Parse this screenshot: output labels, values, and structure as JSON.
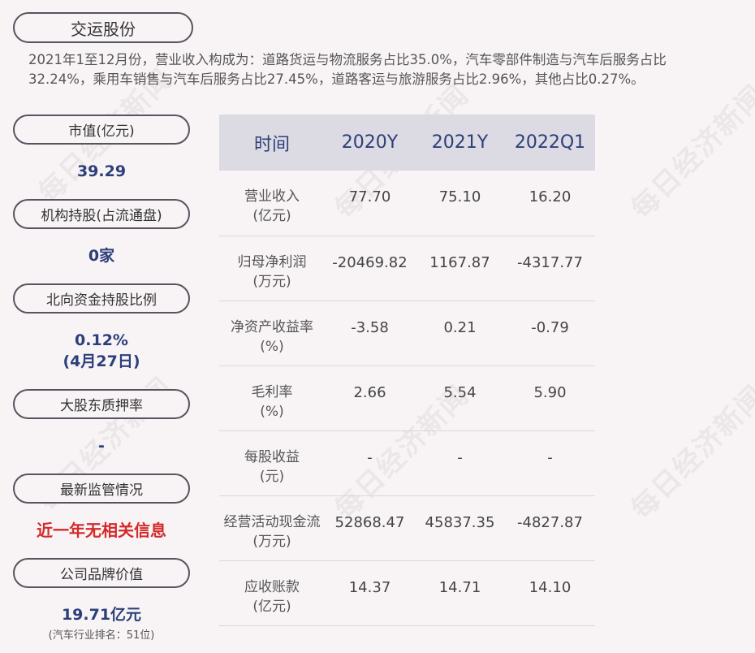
{
  "title": "交运股份",
  "summary": "2021年1至12月份，营业收入构成为：道路货运与物流服务占比35.0%，汽车零部件制造与汽车后服务占比32.24%，乘用车销售与汽车后服务占比27.45%，道路客运与旅游服务占比2.96%，其他占比0.27%。",
  "side": {
    "market_cap_label": "市值(亿元)",
    "market_cap_value": "39.29",
    "inst_label": "机构持股(占流通盘)",
    "inst_value": "0家",
    "north_label": "北向资金持股比例",
    "north_value": "0.12%",
    "north_date": "(4月27日)",
    "pledge_label": "大股东质押率",
    "pledge_value": "-",
    "reg_label": "最新监管情况",
    "reg_value": "近一年无相关信息",
    "brand_label": "公司品牌价值",
    "brand_value": "19.71亿元",
    "brand_note": "(汽车行业排名：51位)"
  },
  "table": {
    "headers": [
      "时间",
      "2020Y",
      "2021Y",
      "2022Q1"
    ],
    "rows": [
      {
        "label1": "营业收入",
        "label2": "(亿元)",
        "v": [
          "77.70",
          "75.10",
          "16.20"
        ]
      },
      {
        "label1": "归母净利润",
        "label2": "(万元)",
        "v": [
          "-20469.82",
          "1167.87",
          "-4317.77"
        ]
      },
      {
        "label1": "净资产收益率",
        "label2": "(%)",
        "v": [
          "-3.58",
          "0.21",
          "-0.79"
        ]
      },
      {
        "label1": "毛利率",
        "label2": "(%)",
        "v": [
          "2.66",
          "5.54",
          "5.90"
        ]
      },
      {
        "label1": "每股收益",
        "label2": "(元)",
        "v": [
          "-",
          "-",
          "-"
        ]
      },
      {
        "label1": "经营活动现金流",
        "label2": "(万元)",
        "v": [
          "52868.47",
          "45837.35",
          "-4827.87"
        ]
      },
      {
        "label1": "应收账款",
        "label2": "(亿元)",
        "v": [
          "14.37",
          "14.71",
          "14.10"
        ]
      }
    ]
  },
  "watermark": "每日经济新闻"
}
